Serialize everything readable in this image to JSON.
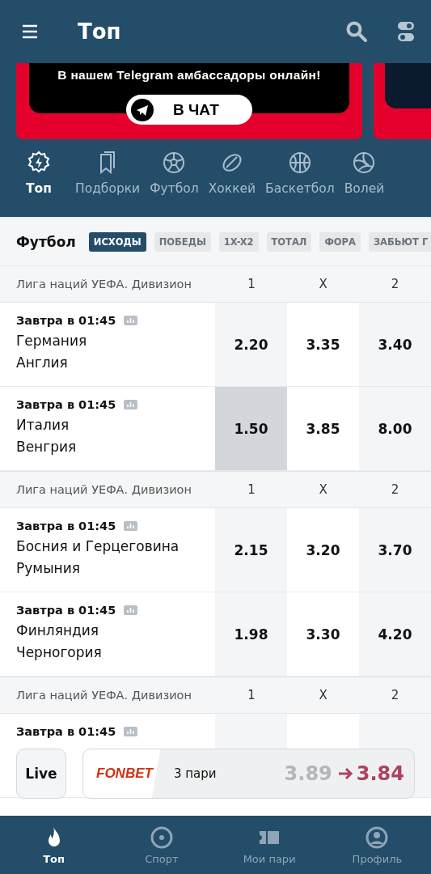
{
  "header": {
    "title": "Топ"
  },
  "banner": {
    "text": "В нашем Telegram амбассадоры онлайн!",
    "button": "В ЧАТ"
  },
  "sport_tabs": [
    {
      "label": "Топ",
      "selected": true
    },
    {
      "label": "Подборки",
      "selected": false
    },
    {
      "label": "Футбол",
      "selected": false
    },
    {
      "label": "Хоккей",
      "selected": false
    },
    {
      "label": "Баскетбол",
      "selected": false
    },
    {
      "label": "Волей",
      "selected": false
    }
  ],
  "section": {
    "title": "Футбол",
    "filters": [
      {
        "label": "ИСХОДЫ",
        "selected": true
      },
      {
        "label": "ПОБЕДЫ",
        "selected": false
      },
      {
        "label": "1X-X2",
        "selected": false
      },
      {
        "label": "ТОТАЛ",
        "selected": false
      },
      {
        "label": "ФОРА",
        "selected": false
      },
      {
        "label": "ЗАБЬЮТ Г",
        "selected": false
      }
    ]
  },
  "leagues": [
    {
      "name": "Лига наций УЕФА. Дивизион",
      "columns": [
        "1",
        "X",
        "2"
      ],
      "matches": [
        {
          "time": "Завтра в 01:45",
          "teams": [
            "Германия",
            "Англия"
          ],
          "odds": [
            {
              "value": "2.20",
              "selected": false
            },
            {
              "value": "3.35",
              "selected": false
            },
            {
              "value": "3.40",
              "selected": false
            }
          ]
        },
        {
          "time": "Завтра в 01:45",
          "teams": [
            "Италия",
            "Венгрия"
          ],
          "odds": [
            {
              "value": "1.50",
              "selected": true
            },
            {
              "value": "3.85",
              "selected": false
            },
            {
              "value": "8.00",
              "selected": false
            }
          ]
        }
      ]
    },
    {
      "name": "Лига наций УЕФА. Дивизион",
      "columns": [
        "1",
        "X",
        "2"
      ],
      "matches": [
        {
          "time": "Завтра в 01:45",
          "teams": [
            "Босния и Герцеговина",
            "Румыния"
          ],
          "odds": [
            {
              "value": "2.15",
              "selected": false
            },
            {
              "value": "3.20",
              "selected": false
            },
            {
              "value": "3.70",
              "selected": false
            }
          ]
        },
        {
          "time": "Завтра в 01:45",
          "teams": [
            "Финляндия",
            "Черногория"
          ],
          "odds": [
            {
              "value": "1.98",
              "selected": false
            },
            {
              "value": "3.30",
              "selected": false
            },
            {
              "value": "4.20",
              "selected": false
            }
          ]
        }
      ]
    },
    {
      "name": "Лига наций УЕФА. Дивизион",
      "columns": [
        "1",
        "X",
        "2"
      ],
      "matches": [
        {
          "time": "Завтра в 01:45"
        }
      ]
    }
  ],
  "bet_slip": {
    "live": "Live",
    "brand": "FONBET",
    "count": "3 пари",
    "old_odds": "3.89",
    "new_odds": "3.84"
  },
  "bottom_nav": [
    {
      "label": "Топ",
      "selected": true
    },
    {
      "label": "Спорт",
      "selected": false
    },
    {
      "label": "Мои пари",
      "selected": false
    },
    {
      "label": "Профиль",
      "selected": false
    }
  ]
}
